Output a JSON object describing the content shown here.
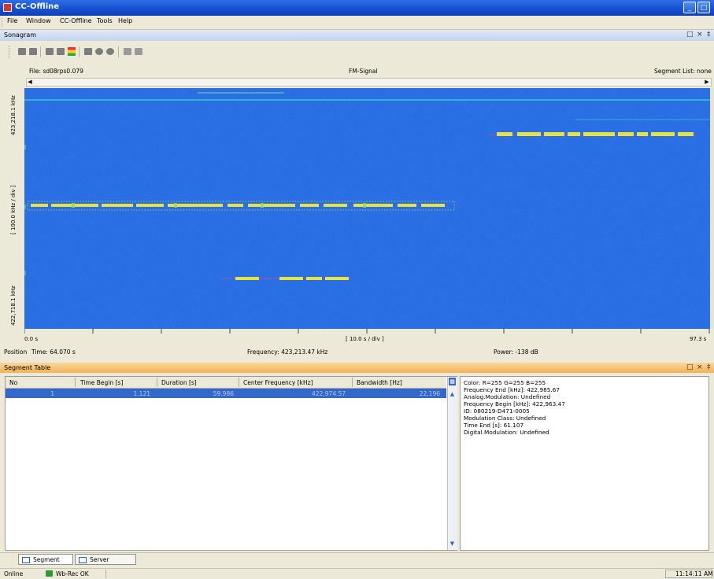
{
  "window": {
    "title": "CC-Offline",
    "min_glyph": "_",
    "max_glyph": "□"
  },
  "menu": [
    "File",
    "Window",
    "CC-Offline",
    "Tools",
    "Help"
  ],
  "sonagram": {
    "panel_title": "Sonagram",
    "header_controls": [
      "□",
      "×",
      "‡"
    ],
    "file_label": "File: sd08rps0.079",
    "signal_label": "FM-Signal",
    "segment_list_label": "Segment List: none",
    "y_top_label": "423,218.1 kHz",
    "y_mid_label": "[ 100.0 kHz / div ]",
    "y_bottom_label": "422,718.1 kHz",
    "x_start_label": "0.0 s",
    "x_div_label": "[ 10.0 s / div ]",
    "x_end_label": "97.3 s",
    "position_label": "Position",
    "time_label": "Time: 64.070 s",
    "frequency_label": "Frequency: 423,213.47 kHz",
    "power_label": "Power: -138 dB"
  },
  "segment_table": {
    "panel_title": "Segment Table",
    "columns": [
      "No",
      "Time Begin [s]",
      "Duration [s]",
      "Center Frequency [kHz]",
      "Bandwidth [Hz]"
    ],
    "rows": [
      [
        "1",
        "1.121",
        "59.986",
        "422,974.57",
        "22,196"
      ]
    ],
    "properties": [
      "Color: R=255 G=255 B=255",
      "Frequency End [kHz]: 422,985.67",
      "Analog.Modulation: Undefined",
      "Frequency Begin [kHz]: 422,963.47",
      "ID: 080219-D471-0005",
      "Modulation Class: Undefined",
      "Time End [s]: 61.107",
      "Digital.Modulation: Undefined"
    ]
  },
  "tabs": [
    "Segment Table",
    "Server Control"
  ],
  "status": {
    "mode": "Online",
    "receiver": "Wb-Rec OK",
    "clock": "11:14:11 AM"
  },
  "colors": {
    "plot_background": "#2168e6",
    "signal_yellow": "#e8e23c",
    "signal_cyan": "#33d6d0",
    "selection_blue": "#3569c9",
    "titlebar_blue": "#0b3fb8",
    "panel_orange": "#f2b35a"
  }
}
